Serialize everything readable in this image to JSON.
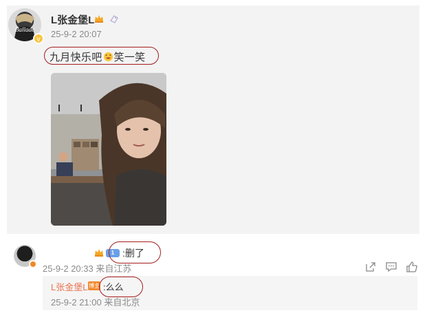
{
  "post": {
    "username": "L张金堡L",
    "time": "25-9-2 20:07",
    "text_before": "九月快乐吧",
    "text_after": "笑一笑",
    "avatar_text": "Ballade"
  },
  "comment": {
    "level_badge": "1",
    "text": ":删了",
    "meta": "25-9-2 20:33 来自江苏"
  },
  "reply": {
    "username": "L张金堡L",
    "badge": "博主",
    "text": ":么么",
    "meta": "25-9-2 21:00 来自北京"
  },
  "colors": {
    "annotation": "#a41c1c",
    "reply_name": "#eb7350",
    "card_bg": "#f3f3f3"
  },
  "icons": {
    "share": "share-icon",
    "comment": "comment-icon",
    "like": "like-icon"
  }
}
